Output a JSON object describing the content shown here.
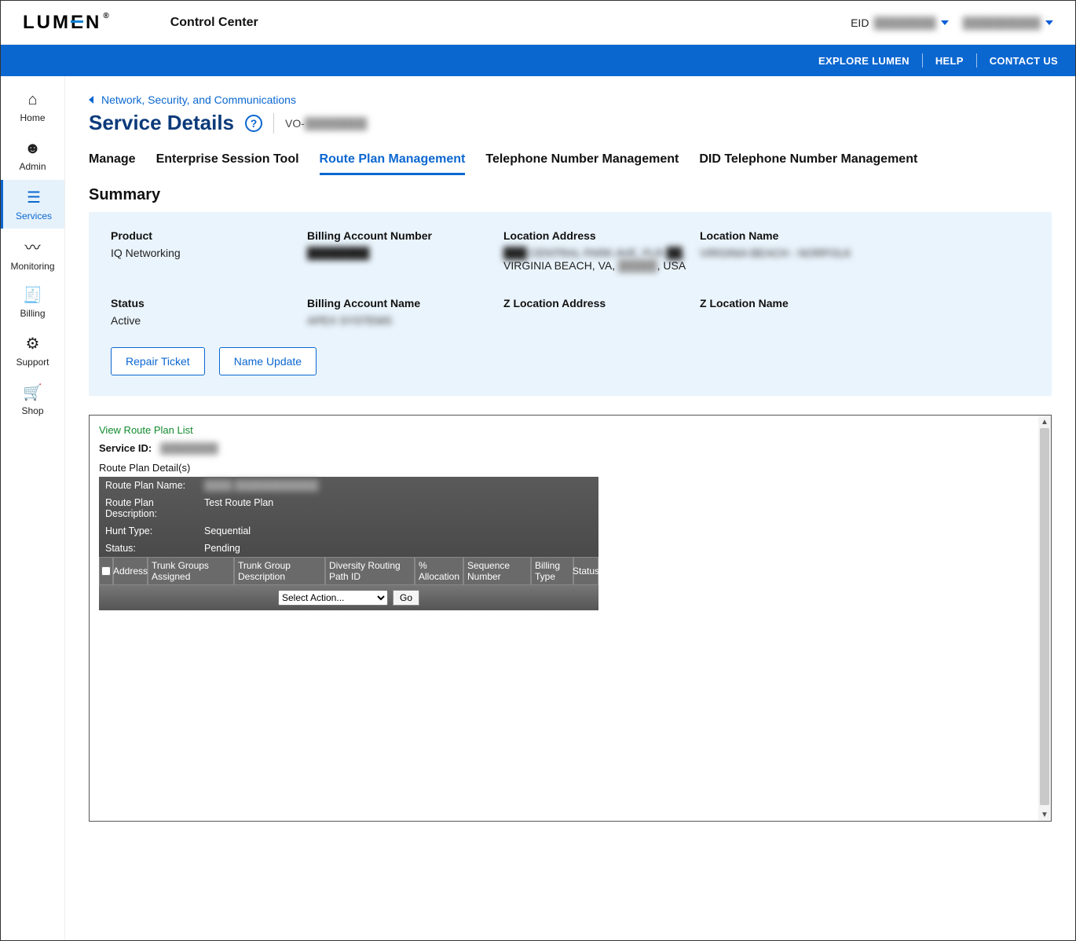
{
  "brand": "LUMEN",
  "app_title": "Control Center",
  "header": {
    "eid_label": "EID",
    "eid_value": "████████",
    "user_value": "██████████"
  },
  "bluebar": {
    "explore": "EXPLORE LUMEN",
    "help": "HELP",
    "contact": "CONTACT US"
  },
  "sidebar": {
    "items": [
      {
        "label": "Home"
      },
      {
        "label": "Admin"
      },
      {
        "label": "Services"
      },
      {
        "label": "Monitoring"
      },
      {
        "label": "Billing"
      },
      {
        "label": "Support"
      },
      {
        "label": "Shop"
      }
    ]
  },
  "breadcrumb": "Network, Security, and Communications",
  "page_title": "Service Details",
  "service_id_prefix": "VO-",
  "service_id_blur": "████████",
  "tabs": {
    "manage": "Manage",
    "est": "Enterprise Session Tool",
    "rpm": "Route Plan Management",
    "tnm": "Telephone Number Management",
    "did": "DID Telephone Number Management"
  },
  "summary_heading": "Summary",
  "summary": {
    "product_label": "Product",
    "product_value": "IQ Networking",
    "ban_label": "Billing Account Number",
    "ban_value": "████████",
    "loc_addr_label": "Location Address",
    "loc_addr_line1": "███ CENTRAL PARK AVE, FLR ██,",
    "loc_addr_line2": "VIRGINIA BEACH, VA, █████, USA",
    "loc_name_label": "Location Name",
    "loc_name_value": "VIRGINIA BEACH - NORFOLK",
    "status_label": "Status",
    "status_value": "Active",
    "ban_name_label": "Billing Account Name",
    "ban_name_value": "APEX SYSTEMS",
    "z_addr_label": "Z Location Address",
    "z_name_label": "Z Location Name"
  },
  "buttons": {
    "repair": "Repair Ticket",
    "name_update": "Name Update"
  },
  "panel": {
    "view_list": "View Route Plan List",
    "service_id_label": "Service ID:",
    "service_id_value": "████████",
    "rp_details_label": "Route Plan Detail(s)",
    "rp_name_label": "Route Plan Name:",
    "rp_name_value": "████ ████████████",
    "rp_desc_label": "Route Plan Description:",
    "rp_desc_value": "Test Route Plan",
    "hunt_label": "Hunt Type:",
    "hunt_value": "Sequential",
    "status_label": "Status:",
    "status_value": "Pending",
    "cols": {
      "address": "Address",
      "tga": "Trunk Groups Assigned",
      "tgd": "Trunk Group Description",
      "drp": "Diversity Routing Path ID",
      "alloc": "% Allocation",
      "seq": "Sequence Number",
      "bill": "Billing Type",
      "status": "Status"
    },
    "select_action": "Select Action...",
    "go": "Go"
  }
}
